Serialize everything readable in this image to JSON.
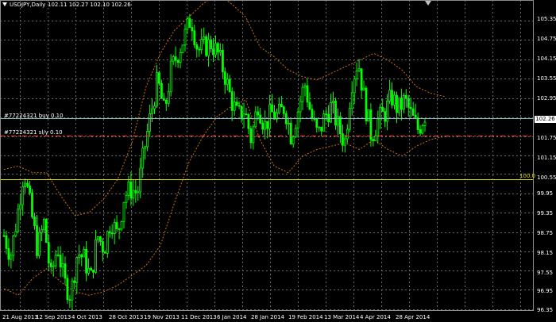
{
  "header": {
    "symbol_period": "USDJPY,Daily",
    "ohlc": "102.11 102.27 102.10 102.26"
  },
  "orders": [
    {
      "label": "#77224321 buy 0.10",
      "price": 102.26,
      "color": "#7fbfbf"
    },
    {
      "label": "#77224321 sl/y 0.10",
      "price": 101.74,
      "color": "#ff3030"
    }
  ],
  "level_line": {
    "label": "100.0",
    "price": 100.42,
    "color": "#d8d800"
  },
  "current_price": {
    "label": "102.26",
    "price": 102.26
  },
  "colors": {
    "background": "#000000",
    "grid": "#6b6b6b",
    "candles": "#00ff00",
    "bands": "#d07000",
    "text": "#ffffff"
  },
  "icons": {
    "dropdown": "triangle-down-icon",
    "scroll": "triangle-down-icon"
  },
  "chart_data": {
    "type": "candlestick",
    "symbol": "USDJPY",
    "timeframe": "Daily",
    "ylim": [
      96.35,
      105.5
    ],
    "y_ticks": [
      "105.35",
      "104.75",
      "104.15",
      "103.55",
      "102.95",
      "102.26",
      "101.75",
      "101.15",
      "100.55",
      "99.95",
      "99.35",
      "98.75",
      "98.15",
      "97.55",
      "96.95",
      "96.35"
    ],
    "x_ticks": [
      "21 Aug 2013",
      "12 Sep 2013",
      "4 Oct 2013",
      "28 Oct 2013",
      "19 Nov 2013",
      "11 Dec 2013",
      "6 Jan 2014",
      "28 Jan 2014",
      "19 Feb 2014",
      "13 Mar 2014",
      "4 Apr 2014",
      "28 Apr 2014"
    ],
    "close_path": [
      98.6,
      98.0,
      99.2,
      100.6,
      99.4,
      98.2,
      99.0,
      97.3,
      98.3,
      97.2,
      96.8,
      98.1,
      97.9,
      97.3,
      98.6,
      98.2,
      99.1,
      98.6,
      99.8,
      100.0,
      99.9,
      101.2,
      102.3,
      103.3,
      102.3,
      103.6,
      104.1,
      104.6,
      105.2,
      104.2,
      104.3,
      104.4,
      104.1,
      103.5,
      102.7,
      102.2,
      102.4,
      101.5,
      102.6,
      101.9,
      102.3,
      102.2,
      102.5,
      101.6,
      102.4,
      103.2,
      102.2,
      101.6,
      102.2,
      102.5,
      101.9,
      101.4,
      103.2,
      103.9,
      102.6,
      101.6,
      102.1,
      102.3,
      102.8,
      102.4,
      102.7,
      102.2,
      101.8,
      102.26
    ],
    "bollinger_upper": [
      100.6,
      100.7,
      100.5,
      100.5,
      99.8,
      99.2,
      99.3,
      99.7,
      100.3,
      101.4,
      103.1,
      104.1,
      104.8,
      105.2,
      105.6,
      105.9,
      105.6,
      105.2,
      104.3,
      104.0,
      103.6,
      103.4,
      103.3,
      103.5,
      103.7,
      103.9,
      104.1,
      103.9,
      103.6,
      103.1,
      102.9,
      102.8
    ],
    "bollinger_lower": [
      97.0,
      96.8,
      97.3,
      97.6,
      97.2,
      96.9,
      96.8,
      96.9,
      97.1,
      97.4,
      97.7,
      98.3,
      99.6,
      100.8,
      101.6,
      102.2,
      102.5,
      102.7,
      101.5,
      100.7,
      100.5,
      101.0,
      101.2,
      101.3,
      101.4,
      101.2,
      101.5,
      101.2,
      101.0,
      101.3,
      101.5,
      101.6
    ]
  }
}
